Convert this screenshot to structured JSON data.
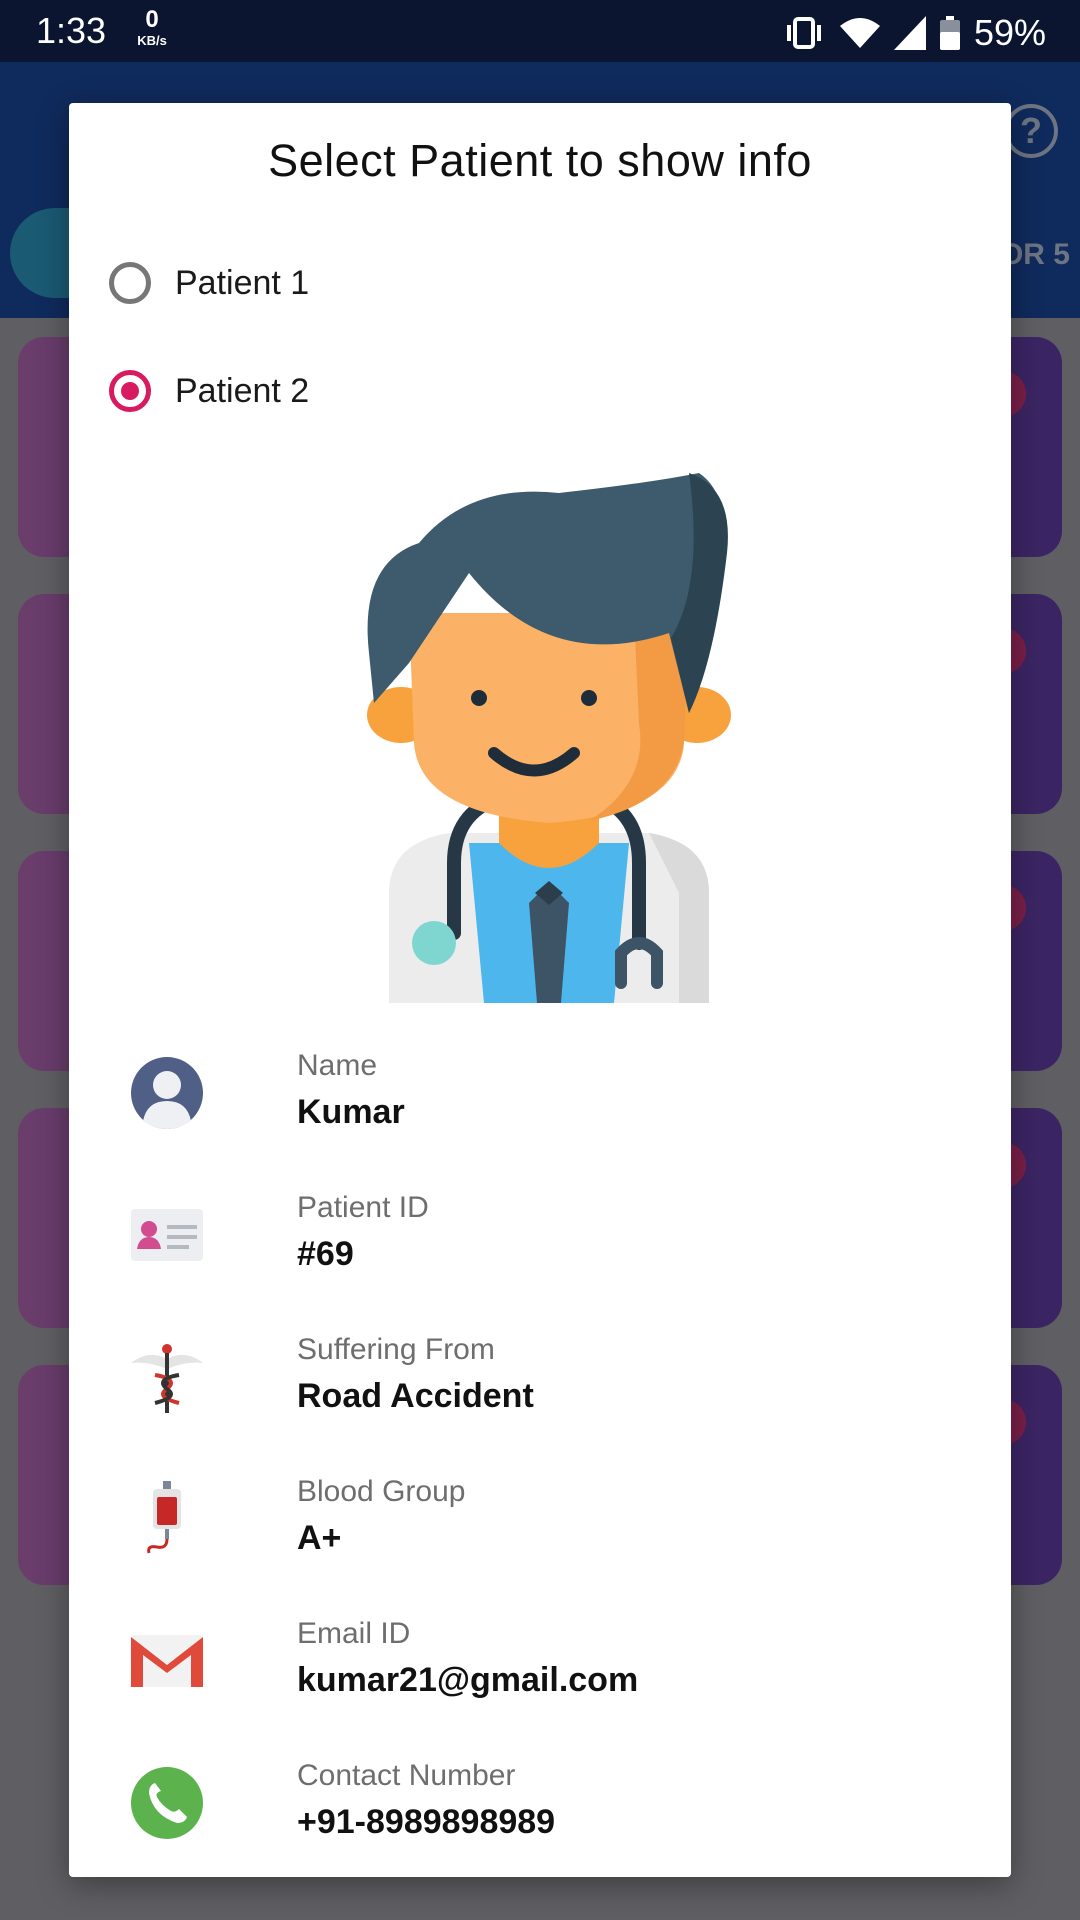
{
  "status_bar": {
    "time": "1:33",
    "net_speed_value": "0",
    "net_speed_unit": "KB/s",
    "battery_percent": "59%"
  },
  "background": {
    "tab_right_label": "OR 5",
    "help_icon": "help-circle-icon"
  },
  "dialog": {
    "title": "Select Patient to show info",
    "options": [
      {
        "label": "Patient 1",
        "selected": false
      },
      {
        "label": "Patient 2",
        "selected": true
      }
    ],
    "fields": [
      {
        "label": "Name",
        "value": "Kumar",
        "icon": "person-icon"
      },
      {
        "label": "Patient ID",
        "value": "#69",
        "icon": "id-card-icon"
      },
      {
        "label": "Suffering From",
        "value": "Road Accident",
        "icon": "caduceus-icon"
      },
      {
        "label": "Blood Group",
        "value": "A+",
        "icon": "blood-bag-icon"
      },
      {
        "label": "Email ID",
        "value": "kumar21@gmail.com",
        "icon": "gmail-icon"
      },
      {
        "label": "Contact Number",
        "value": "+91-8989898989",
        "icon": "phone-icon"
      }
    ]
  },
  "colors": {
    "accent": "#d81b60",
    "header": "#0f2a5c",
    "card_start": "#6a3d6b",
    "card_end": "#3a2463"
  }
}
